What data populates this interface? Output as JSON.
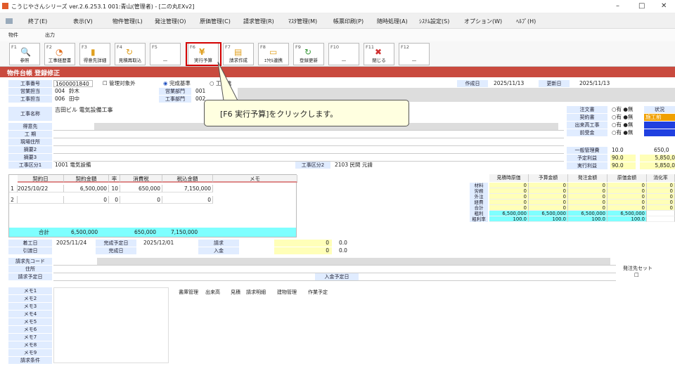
{
  "window": {
    "title": "こうじやさんシリーズ ver.2.6.253.1 001:青山(管理者) - [二の丸EXv2]",
    "minimize": "–",
    "maximize": "□",
    "close": "✕"
  },
  "menu": [
    "終了(E)",
    "表示(V)",
    "物件管理(L)",
    "発注管理(O)",
    "原価管理(C)",
    "請求管理(R)",
    "ﾏｽﾀ管理(M)",
    "帳票印刷(P)",
    "随時処理(A)",
    "ｼｽﾃﾑ設定(S)",
    "オプション(W)",
    "ﾍﾙﾌﾟ(H)"
  ],
  "toolbar2": {
    "item1": "物件",
    "item2": "出力"
  },
  "fkeys": [
    {
      "k": "F1",
      "l": "参照",
      "ic": "🔍"
    },
    {
      "k": "F2",
      "l": "工事経歴書",
      "ic": "◔"
    },
    {
      "k": "F3",
      "l": "得意先詳細",
      "ic": "▮"
    },
    {
      "k": "F4",
      "l": "見積再取込",
      "ic": "↻"
    },
    {
      "k": "F5",
      "l": "—",
      "ic": ""
    },
    {
      "k": "F6",
      "l": "実行予算",
      "ic": "¥"
    },
    {
      "k": "F7",
      "l": "請求作成",
      "ic": "▤"
    },
    {
      "k": "F8",
      "l": "ｴｸｾﾙ連携",
      "ic": "▭"
    },
    {
      "k": "F9",
      "l": "登録更新",
      "ic": "↻"
    },
    {
      "k": "F10",
      "l": "—",
      "ic": ""
    },
    {
      "k": "F11",
      "l": "閉じる",
      "ic": "✖"
    },
    {
      "k": "F12",
      "l": "—",
      "ic": ""
    }
  ],
  "header": {
    "title": "物件台帳 登録修正"
  },
  "form": {
    "koji_no_label": "工事番号",
    "koji_no": "1600001840",
    "kanri_label": "管理対象外",
    "kansei_label": "完成基準",
    "shinko_label": "工事進",
    "sakusei_label": "作成日",
    "sakusei": "2025/11/13",
    "koshin_label": "更新日",
    "koshin": "2025/11/13",
    "eigyo_label": "営業担当",
    "eigyo_code": "004",
    "eigyo_name": "鈴木",
    "eigyo_bumon_label": "営業部門",
    "eigyo_bumon": "001",
    "koji_tanto_label": "工事担当",
    "koji_tanto_code": "006",
    "koji_tanto_name": "田中",
    "koji_bumon_label": "工事部門",
    "koji_bumon": "002",
    "koji_mei_label": "工事名称",
    "koji_mei": "吉田ビル 電気設備工事",
    "tokui_label": "得意先",
    "kouki_label": "工 期",
    "genba_label": "現場住所",
    "tekiyo2_label": "摘要2",
    "tekiyo3_label": "摘要3",
    "kubun1_label": "工事区分1",
    "kubun1": "1001 電気設備",
    "kubun2_label": "工事区分2",
    "kubun2": "2103 民間 元請"
  },
  "right_panel": {
    "rows": [
      {
        "l": "注文書",
        "v": "○有 ●無"
      },
      {
        "l": "契約書",
        "v": "○有 ●無"
      },
      {
        "l": "出来高工事",
        "v": "○有 ●無"
      },
      {
        "l": "前受金",
        "v": "○有 ●無"
      }
    ],
    "status_label": "状況",
    "status": "施工前",
    "ippan_label": "一般管理費",
    "ippan_rate": "10.0",
    "ippan_val": "650,0",
    "yotei_label": "予定利益",
    "yotei_rate": "90.0",
    "yotei_val": "5,850,0",
    "jikko_label": "実行利益",
    "jikko_rate": "90.0",
    "jikko_val": "5,850,0"
  },
  "contract": {
    "headers": [
      "契約日",
      "契約金額",
      "率",
      "消費税",
      "税込金額",
      "メモ"
    ],
    "rows": [
      {
        "no": "1",
        "date": "2025/10/22",
        "amount": "6,500,000",
        "rate": "10",
        "tax": "650,000",
        "total": "7,150,000"
      },
      {
        "no": "2",
        "date": "",
        "amount": "0",
        "rate": "0",
        "tax": "0",
        "total": "0"
      }
    ],
    "total_label": "合計",
    "total_amount": "6,500,000",
    "total_tax": "650,000",
    "total_total": "7,150,000"
  },
  "cost": {
    "headers": [
      "見積時原価",
      "予算金額",
      "発注金額",
      "原価金額",
      "消化率"
    ],
    "rows": [
      {
        "l": "材料",
        "v": [
          "0",
          "0",
          "0",
          "0",
          "0"
        ]
      },
      {
        "l": "労務",
        "v": [
          "0",
          "0",
          "0",
          "0",
          "0"
        ]
      },
      {
        "l": "外注",
        "v": [
          "0",
          "0",
          "0",
          "0",
          "0"
        ]
      },
      {
        "l": "経費",
        "v": [
          "0",
          "0",
          "0",
          "0",
          "0"
        ]
      },
      {
        "l": "合計",
        "v": [
          "0",
          "0",
          "0",
          "0",
          "0"
        ]
      },
      {
        "l": "粗利",
        "v": [
          "6,500,000",
          "6,500,000",
          "6,500,000",
          "6,500,000",
          ""
        ]
      },
      {
        "l": "粗利率",
        "v": [
          "100.0",
          "100.0",
          "100.0",
          "100.0",
          ""
        ]
      }
    ]
  },
  "dates": {
    "chakko_label": "着工日",
    "chakko": "2025/11/24",
    "kanyo_label": "完成予定日",
    "kanyo": "2025/12/01",
    "seikyu_label": "請求",
    "seikyu": "0",
    "seikyu2": "0.0",
    "hikiwatashi_label": "引渡日",
    "kansei_label": "完成日",
    "nyukin_label": "入金",
    "nyukin": "0",
    "nyukin2": "0.0"
  },
  "billing": {
    "code_label": "請求先コード",
    "addr_label": "住所",
    "yotei_label": "請求予定日",
    "nyukin_yotei_label": "入金予定日",
    "hachu_set_label": "発注先セット"
  },
  "memos": [
    "メモ1",
    "メモ2",
    "メモ3",
    "メモ4",
    "メモ5",
    "メモ6",
    "メモ7",
    "メモ8",
    "メモ9",
    "請求条件"
  ],
  "tabs": [
    "書庫管理",
    "出来高",
    "見積",
    "請求明細",
    "建物管理",
    "作業予定"
  ],
  "callout": {
    "text": "[F6 実行予算]をクリックします。"
  },
  "colors": {
    "header_red": "#c94a3e",
    "label_blue": "#e0ecff",
    "highlight_red": "#d40000",
    "yellow": "#ffffb8",
    "cyan": "#7fffff"
  }
}
